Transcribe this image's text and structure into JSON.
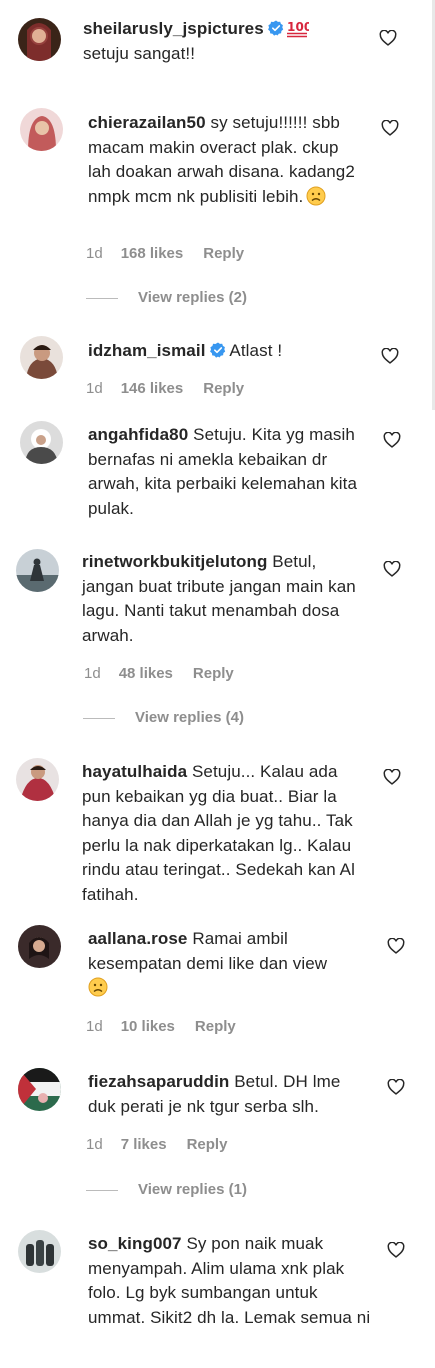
{
  "comments": [
    {
      "username": "sheilarusly_jspictures",
      "verified": true,
      "text": "setuju sangat!!",
      "emoji": "hundred",
      "time": "",
      "likes": "",
      "reply": "",
      "view_replies": "",
      "avatar_color": "#8a2f2f"
    },
    {
      "username": "chierazailan50",
      "verified": false,
      "text": "sy setuju!!!!!! sbb macam makin overact plak. ckup lah doakan arwah disana. kadang2 nmpk mcm nk publisiti lebih.",
      "emoji": "sad",
      "time": "1d",
      "likes": "168 likes",
      "reply": "Reply",
      "view_replies": "View replies (2)",
      "avatar_color": "#c25b5b"
    },
    {
      "username": "idzham_ismail",
      "verified": true,
      "text": "Atlast !",
      "emoji": "",
      "time": "1d",
      "likes": "146 likes",
      "reply": "Reply",
      "view_replies": "",
      "avatar_color": "#7a4a3a"
    },
    {
      "username": "angahfida80",
      "verified": false,
      "text": "Setuju. Kita yg masih bernafas ni amekla kebaikan dr arwah, kita perbaiki kelemahan kita pulak.",
      "emoji": "",
      "time": "",
      "likes": "",
      "reply": "",
      "view_replies": "",
      "avatar_color": "#4a4a4a"
    },
    {
      "username": "rinetworkbukitjelutong",
      "verified": false,
      "text": "Betul, jangan buat tribute jangan main kan lagu. Nanti takut menambah dosa arwah.",
      "emoji": "",
      "time": "1d",
      "likes": "48 likes",
      "reply": "Reply",
      "view_replies": "View replies (4)",
      "avatar_color": "#5a6a70"
    },
    {
      "username": "hayatulhaida",
      "verified": false,
      "text": "Setuju... Kalau ada pun kebaikan yg dia buat.. Biar la hanya dia dan Allah je yg tahu.. Tak perlu la nak diperkatakan lg.. Kalau rindu atau teringat.. Sedekah kan Al fatihah.",
      "emoji": "",
      "time": "",
      "likes": "",
      "reply": "",
      "view_replies": "",
      "avatar_color": "#b03040"
    },
    {
      "username": "aallana.rose",
      "verified": false,
      "text": "Ramai ambil kesempatan demi like dan view",
      "emoji": "sad",
      "time": "1d",
      "likes": "10 likes",
      "reply": "Reply",
      "view_replies": "",
      "avatar_color": "#3a2a2a"
    },
    {
      "username": "fiezahsaparuddin",
      "verified": false,
      "text": "Betul. DH lme duk perati je nk tgur serba slh.",
      "emoji": "",
      "time": "1d",
      "likes": "7 likes",
      "reply": "Reply",
      "view_replies": "View replies (1)",
      "avatar_color": "#3a7a5a"
    },
    {
      "username": "so_king007",
      "verified": false,
      "text": "Sy pon naik muak menyampah. Alim ulama xnk plak folo. Lg byk sumbangan untuk ummat. Sikit2 dh la. Lemak semua ni",
      "emoji": "",
      "time": "",
      "likes": "",
      "reply": "",
      "view_replies": "",
      "avatar_color": "#6a7a7a"
    }
  ],
  "colors": {
    "text": "#262626",
    "secondary": "#8e8e8e",
    "verified": "#3897f0"
  }
}
